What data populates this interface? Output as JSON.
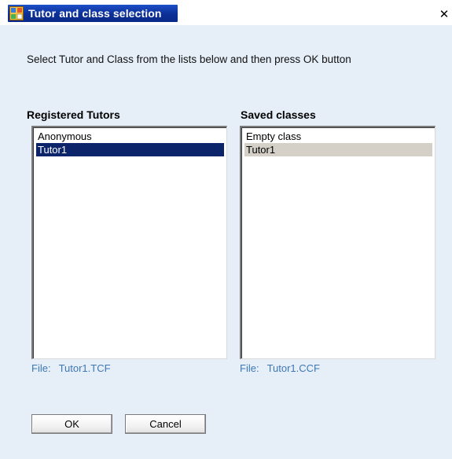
{
  "window": {
    "title": "Tutor and class selection",
    "app_icon": "app-window-icon",
    "close_glyph": "✕"
  },
  "instructions": "Select Tutor and Class from the lists below and then press OK button",
  "tutors": {
    "label": "Registered Tutors",
    "items": [
      "Anonymous",
      "Tutor1"
    ],
    "selected_index": 1,
    "file_label": "File:",
    "file_value": "Tutor1.TCF"
  },
  "classes": {
    "label": "Saved classes",
    "items": [
      "Empty class",
      "Tutor1"
    ],
    "selected_index": 1,
    "file_label": "File:",
    "file_value": "Tutor1.CCF"
  },
  "buttons": {
    "ok": "OK",
    "cancel": "Cancel"
  },
  "colors": {
    "dialog_background": "#e6eef8",
    "title_gradient": "#0c2f96",
    "active_selection": "#0b246a",
    "inactive_selection": "#d4d0c8",
    "file_text": "#3d78b5"
  }
}
